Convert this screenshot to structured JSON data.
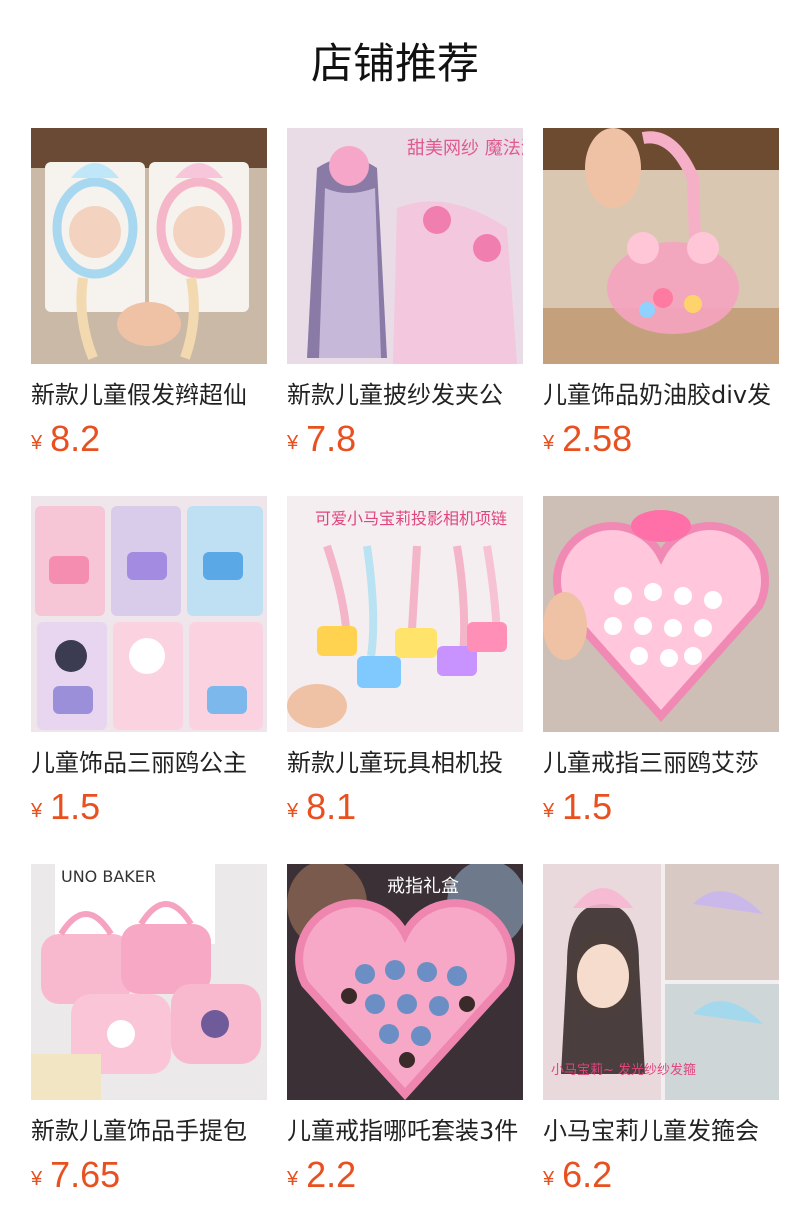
{
  "page": {
    "title": "店铺推荐"
  },
  "currency_symbol": "¥",
  "products": [
    {
      "name": "新款儿童假发辫超仙",
      "price": "8.2",
      "image_text": ""
    },
    {
      "name": "新款儿童披纱发夹公",
      "price": "7.8",
      "image_text": "甜美网纱 魔法渐变发夹"
    },
    {
      "name": "儿童饰品奶油胶div发",
      "price": "2.58",
      "image_text": ""
    },
    {
      "name": "儿童饰品三丽鸥公主",
      "price": "1.5",
      "image_text": ""
    },
    {
      "name": "新款儿童玩具相机投",
      "price": "8.1",
      "image_text": "可爱小马宝莉投影相机项链"
    },
    {
      "name": "儿童戒指三丽鸥艾莎",
      "price": "1.5",
      "image_text": ""
    },
    {
      "name": "新款儿童饰品手提包",
      "price": "7.65",
      "image_text": "UNO BAKER"
    },
    {
      "name": "儿童戒指哪吒套装3件",
      "price": "2.2",
      "image_text": "戒指礼盒"
    },
    {
      "name": "小马宝莉儿童发箍会",
      "price": "6.2",
      "image_text": "小马宝莉~ 发光纱纱发箍"
    }
  ]
}
